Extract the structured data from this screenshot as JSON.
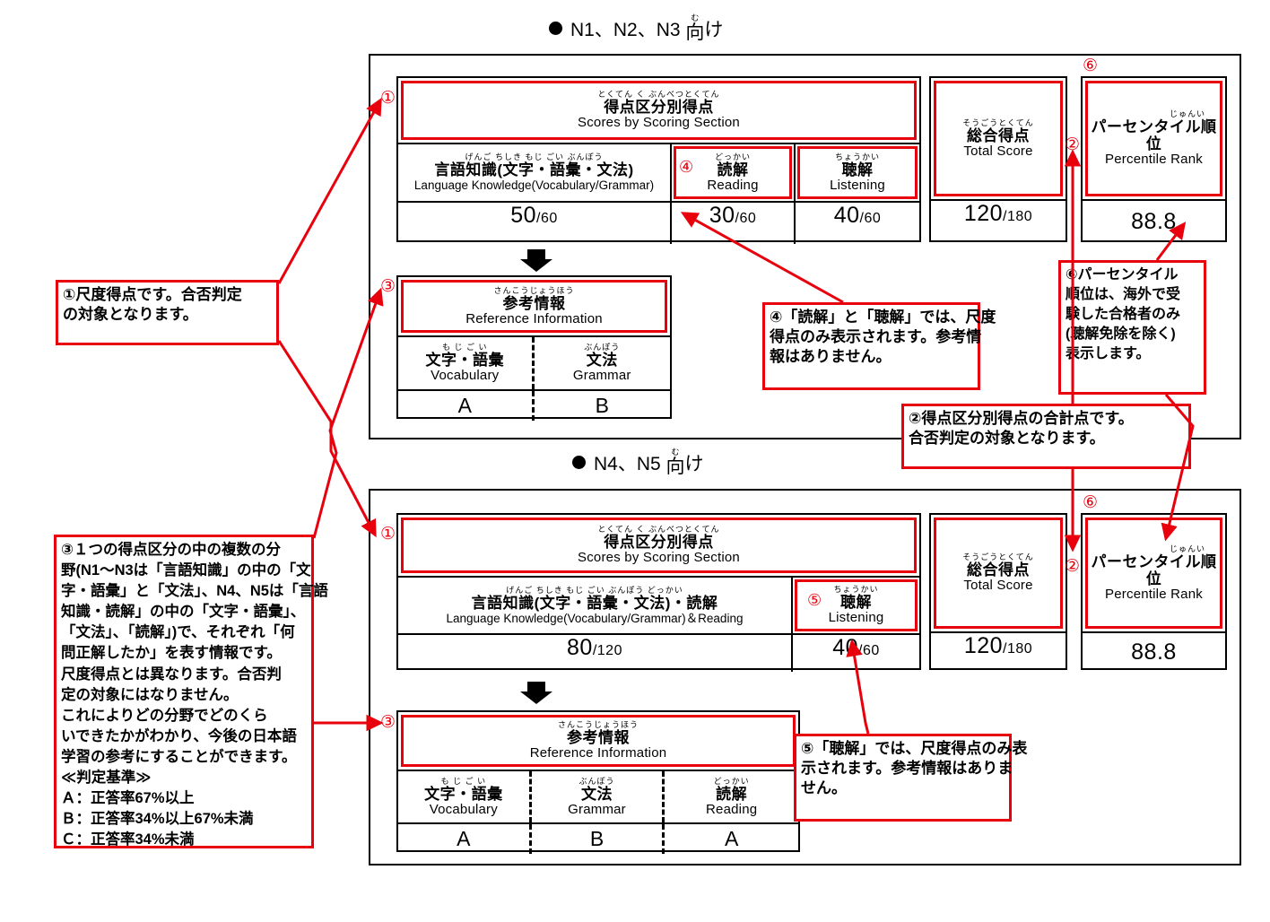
{
  "sections": [
    {
      "id": "n1n3",
      "title_prefix": "N1、N2、N3 ",
      "title_ruby": "む",
      "title_base": "向",
      "title_suffix": "け"
    },
    {
      "id": "n4n5",
      "title_prefix": "N4、N5 ",
      "title_ruby": "む",
      "title_base": "向",
      "title_suffix": "け"
    }
  ],
  "headings": {
    "n1n3": "● N1、N2、N3 向け",
    "n4n5": "● N4、N5 向け"
  },
  "scores_table": {
    "header_ruby": "とくてん く ぶんべつとくてん",
    "header_jp": "得点区分別得点",
    "header_en": "Scores by Scoring Section",
    "total_ruby": "そうごうとくてん",
    "total_jp": "総合得点",
    "total_en": "Total Score",
    "percentile_ruby": "じゅんい",
    "percentile_jp": "パーセンタイル順位",
    "percentile_en": "Percentile Rank"
  },
  "reference_table": {
    "header_ruby": "さんこうじょうほう",
    "header_jp": "参考情報",
    "header_en": "Reference Information"
  },
  "n1n3": {
    "columns": [
      {
        "marker": "",
        "ruby": "げんご ちしき もじ ごい ぶんぽう",
        "jp": "言語知識(文字・語彙・文法)",
        "en": "Language Knowledge(Vocabulary/Grammar)",
        "value": "50",
        "denominator": "/60",
        "highlight": false
      },
      {
        "marker": "④",
        "ruby": "どっかい",
        "jp": "読解",
        "en": "Reading",
        "value": "30",
        "denominator": "/60",
        "highlight": true
      },
      {
        "marker": "",
        "ruby": "ちょうかい",
        "jp": "聴解",
        "en": "Listening",
        "value": "40",
        "denominator": "/60",
        "highlight": true
      }
    ],
    "total_value": "120",
    "total_denominator": "/180",
    "percentile_value": "88.8",
    "reference_columns": [
      {
        "ruby": "も じ   ご い",
        "jp": "文字・語彙",
        "en": "Vocabulary",
        "grade": "A"
      },
      {
        "ruby": "ぶんぽう",
        "jp": "文法",
        "en": "Grammar",
        "grade": "B"
      }
    ]
  },
  "n4n5": {
    "columns": [
      {
        "marker": "",
        "ruby": "げんご ちしき もじ ごい ぶんぽう どっかい",
        "jp": "言語知識(文字・語彙・文法)・読解",
        "en": "Language Knowledge(Vocabulary/Grammar)＆Reading",
        "value": "80",
        "denominator": "/120",
        "highlight": false
      },
      {
        "marker": "⑤",
        "ruby": "ちょうかい",
        "jp": "聴解",
        "en": "Listening",
        "value": "40",
        "denominator": "/60",
        "highlight": true
      }
    ],
    "total_value": "120",
    "total_denominator": "/180",
    "percentile_value": "88.8",
    "reference_columns": [
      {
        "ruby": "も じ   ご い",
        "jp": "文字・語彙",
        "en": "Vocabulary",
        "grade": "A"
      },
      {
        "ruby": "ぶんぽう",
        "jp": "文法",
        "en": "Grammar",
        "grade": "B"
      },
      {
        "ruby": "どっかい",
        "jp": "読解",
        "en": "Reading",
        "grade": "A"
      }
    ]
  },
  "markers": {
    "m1_top": "①",
    "m1_bottom": "①",
    "m2_top": "②",
    "m2_bottom": "②",
    "m3_top": "③",
    "m3_bottom": "③",
    "m4": "④",
    "m5": "⑤",
    "m6_top": "⑥",
    "m6_bottom": "⑥"
  },
  "notes": {
    "note1": {
      "lines": [
        "①尺度得点です。合否判定",
        "の対象となります。"
      ]
    },
    "note3": {
      "lines": [
        "③１つの得点区分の中の複数の分",
        "野(N1〜N3は「言語知識」の中の「文",
        "字・語彙」と「文法」、N4、N5は「言語",
        "知識・読解」の中の「文字・語彙」、",
        "「文法」、「読解」)で、それぞれ「何",
        "問正解したか」を表す情報です。",
        "尺度得点とは異なります。合否判",
        "定の対象にはなりません。",
        "これによりどの分野でどのくら",
        "いできたかがわかり、今後の日本語",
        "学習の参考にすることができます。",
        "≪判定基準≫",
        "Ａ：正答率67%以上",
        "Ｂ：正答率34%以上67%未満",
        "Ｃ：正答率34%未満"
      ]
    },
    "note4": {
      "lines": [
        "④「読解」と「聴解」では、尺度",
        "得点のみ表示されます。参考情",
        "報はありません。"
      ]
    },
    "note5": {
      "lines": [
        "⑤「聴解」では、尺度得点のみ表",
        "示されます。参考情報はありま",
        "せん。"
      ]
    },
    "note2": {
      "lines": [
        "②得点区分別得点の合計点です。",
        "合否判定の対象となります。"
      ]
    },
    "note6": {
      "lines": [
        "⑥パーセンタイル",
        "順位は、海外で受",
        "験した合格者のみ",
        "(聴解免除を除く)",
        "表示します。"
      ]
    }
  },
  "colors": {
    "accent_red": "#e8000d",
    "line_black": "#000000",
    "background": "#ffffff"
  }
}
